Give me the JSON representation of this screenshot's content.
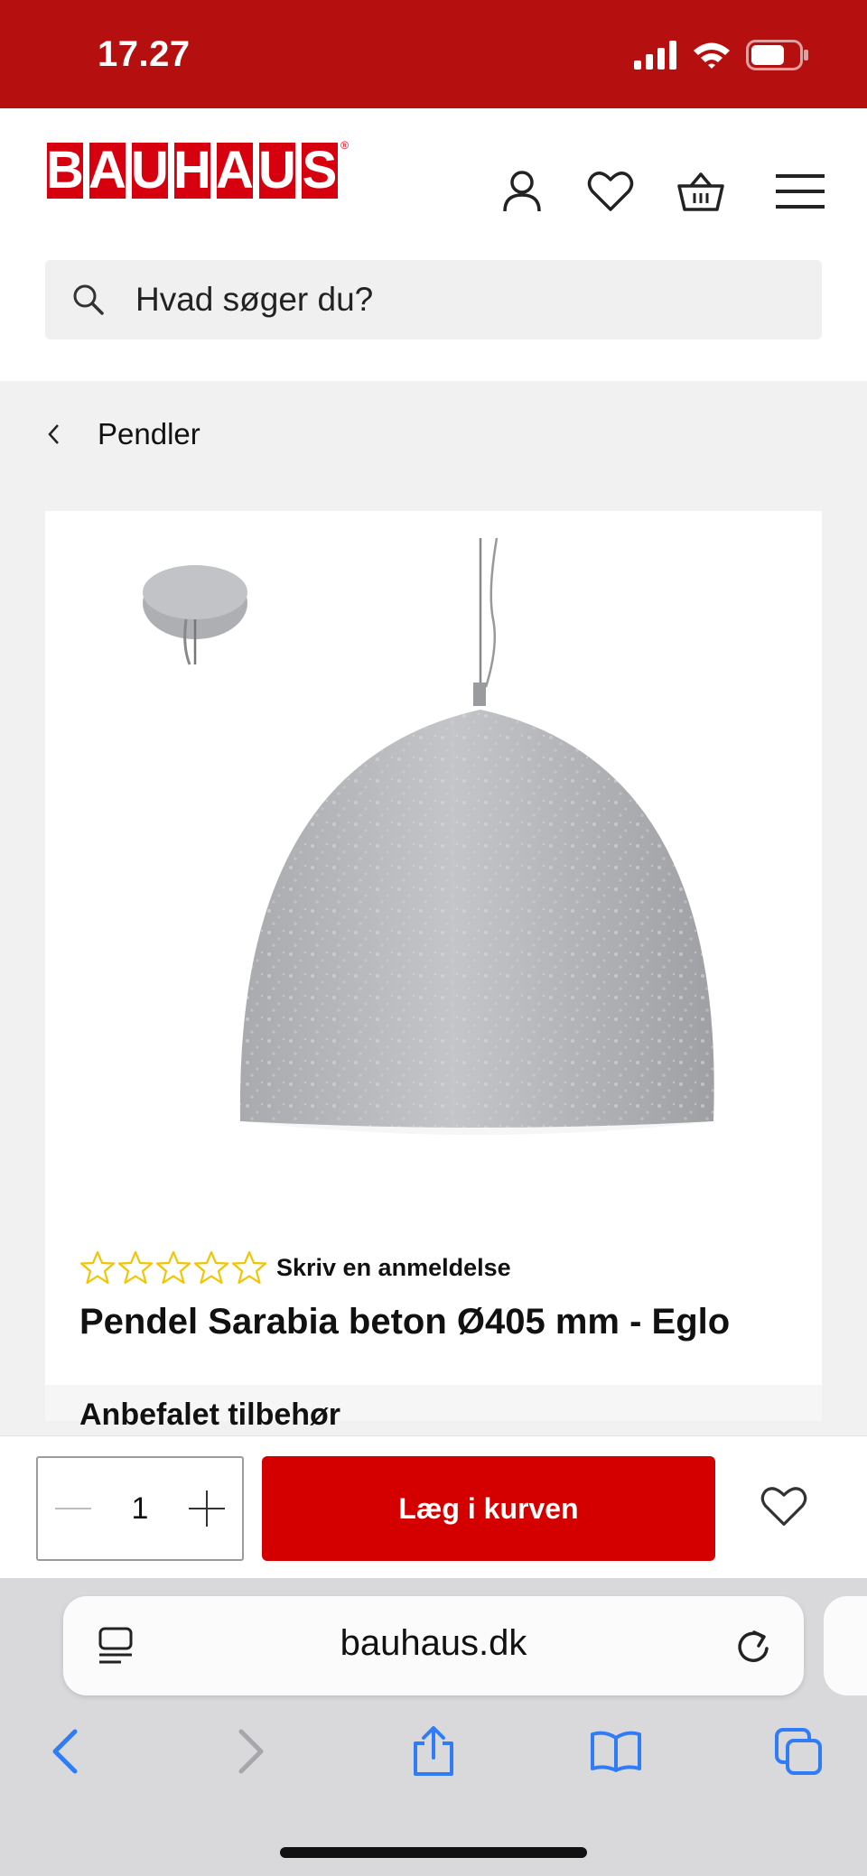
{
  "status": {
    "time": "17.27"
  },
  "header": {
    "logo_letters": [
      "B",
      "A",
      "U",
      "H",
      "A",
      "U",
      "S"
    ],
    "logo_reg": "®",
    "search_placeholder": "Hvad søger du?"
  },
  "breadcrumb": {
    "label": "Pendler"
  },
  "product": {
    "review_link": "Skriv en anmeldelse",
    "rating_stars": 0,
    "rating_max": 5,
    "title": "Pendel Sarabia beton Ø405 mm - Eglo",
    "next_section_peek": "Anbefalet tilbehør"
  },
  "cart": {
    "quantity": "1",
    "add_label": "Læg i kurven"
  },
  "browser": {
    "url": "bauhaus.dk"
  },
  "colors": {
    "brand_red": "#d6000f",
    "status_red": "#b50f0f",
    "button_red": "#d40000",
    "star_yellow": "#f5c400",
    "ios_blue": "#2f7cf6"
  }
}
